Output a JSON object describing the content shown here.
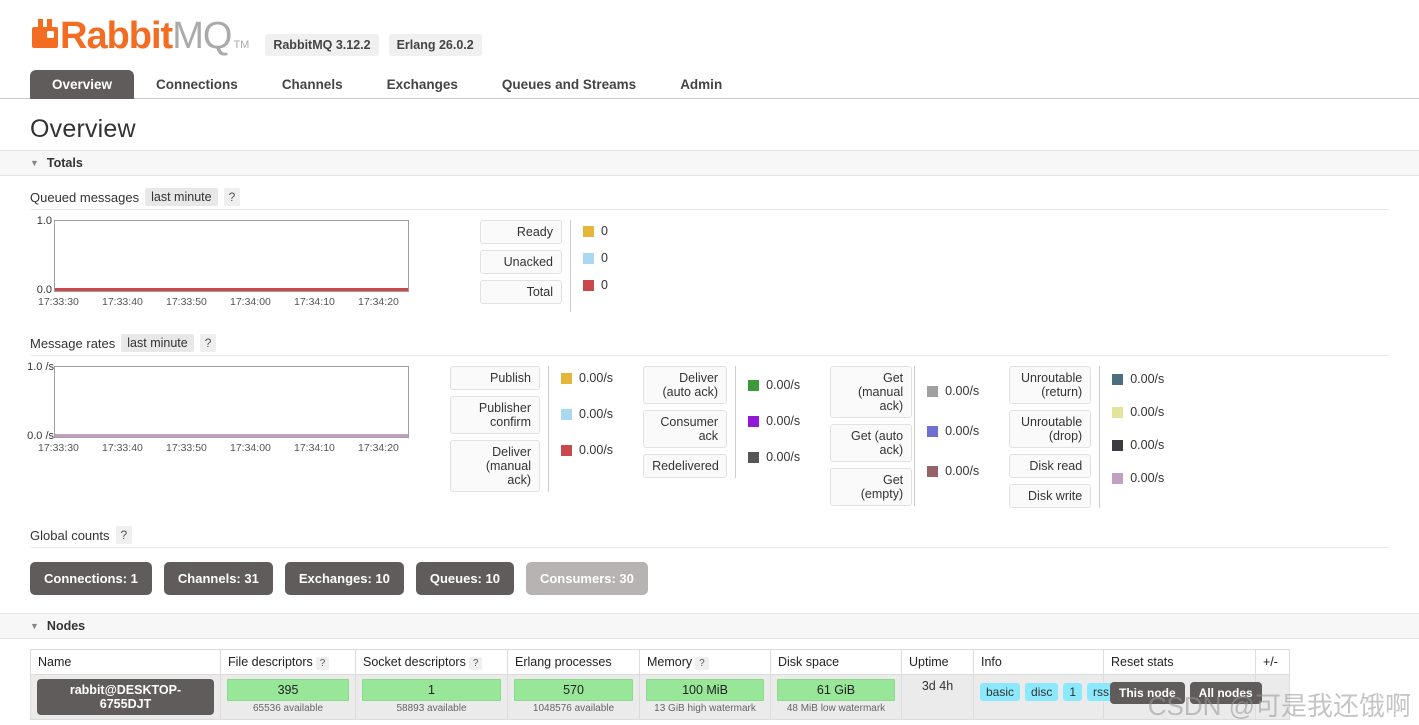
{
  "brand": {
    "name_primary": "Rabbit",
    "name_secondary": "MQ",
    "trademark": "TM",
    "logo_color": "#f36c21",
    "versions": [
      {
        "label": "RabbitMQ 3.12.2"
      },
      {
        "label": "Erlang 26.0.2"
      }
    ]
  },
  "nav": {
    "tabs": [
      {
        "label": "Overview",
        "active": true
      },
      {
        "label": "Connections",
        "active": false
      },
      {
        "label": "Channels",
        "active": false
      },
      {
        "label": "Exchanges",
        "active": false
      },
      {
        "label": "Queues and Streams",
        "active": false
      },
      {
        "label": "Admin",
        "active": false
      }
    ]
  },
  "page": {
    "title": "Overview"
  },
  "sections": {
    "totals": {
      "label": "Totals",
      "expanded": true
    },
    "nodes": {
      "label": "Nodes",
      "expanded": true
    }
  },
  "queued_messages": {
    "label": "Queued messages",
    "period_chip": "last minute",
    "help": "?",
    "legend": [
      {
        "name": "Ready",
        "value": "0",
        "color": "#e5b63c"
      },
      {
        "name": "Unacked",
        "value": "0",
        "color": "#a9d9f0"
      },
      {
        "name": "Total",
        "value": "0",
        "color": "#c9484b"
      }
    ]
  },
  "message_rates": {
    "label": "Message rates",
    "period_chip": "last minute",
    "help": "?",
    "legend_groups": [
      {
        "items": [
          {
            "name": "Publish",
            "value": "0.00/s",
            "color": "#e5b63c"
          },
          {
            "name": "Publisher confirm",
            "value": "0.00/s",
            "color": "#a9d9f0"
          },
          {
            "name": "Deliver (manual ack)",
            "value": "0.00/s",
            "color": "#c9484b"
          }
        ]
      },
      {
        "items": [
          {
            "name": "Deliver (auto ack)",
            "value": "0.00/s",
            "color": "#3c9a3c"
          },
          {
            "name": "Consumer ack",
            "value": "0.00/s",
            "color": "#9317d8"
          },
          {
            "name": "Redelivered",
            "value": "0.00/s",
            "color": "#565656"
          }
        ]
      },
      {
        "items": [
          {
            "name": "Get (manual ack)",
            "value": "0.00/s",
            "color": "#a0a0a0"
          },
          {
            "name": "Get (auto ack)",
            "value": "0.00/s",
            "color": "#6f6fd0"
          },
          {
            "name": "Get (empty)",
            "value": "0.00/s",
            "color": "#96636a"
          }
        ]
      },
      {
        "items": [
          {
            "name": "Unroutable (return)",
            "value": "0.00/s",
            "color": "#4c6f7f"
          },
          {
            "name": "Unroutable (drop)",
            "value": "0.00/s",
            "color": "#e3e39b"
          },
          {
            "name": "Disk read",
            "value": "0.00/s",
            "color": "#3b3b42"
          },
          {
            "name": "Disk write",
            "value": "0.00/s",
            "color": "#c39ec3"
          }
        ]
      }
    ]
  },
  "global_counts": {
    "label": "Global counts",
    "help": "?",
    "badges": [
      {
        "label": "Connections: 1",
        "muted": false
      },
      {
        "label": "Channels: 31",
        "muted": false
      },
      {
        "label": "Exchanges: 10",
        "muted": false
      },
      {
        "label": "Queues: 10",
        "muted": false
      },
      {
        "label": "Consumers: 30",
        "muted": true
      }
    ]
  },
  "nodes_table": {
    "columns": [
      {
        "label": "Name",
        "help": false
      },
      {
        "label": "File descriptors",
        "help": true
      },
      {
        "label": "Socket descriptors",
        "help": true
      },
      {
        "label": "Erlang processes",
        "help": false
      },
      {
        "label": "Memory",
        "help": true
      },
      {
        "label": "Disk space",
        "help": false
      },
      {
        "label": "Uptime",
        "help": false
      },
      {
        "label": "Info",
        "help": false
      },
      {
        "label": "Reset stats",
        "help": false
      },
      {
        "label": "+/-",
        "help": false
      }
    ],
    "row": {
      "name": "rabbit@DESKTOP-6755DJT",
      "file_descriptors": {
        "value": "395",
        "note": "65536 available"
      },
      "socket_descriptors": {
        "value": "1",
        "note": "58893 available"
      },
      "erlang_processes": {
        "value": "570",
        "note": "1048576 available"
      },
      "memory": {
        "value": "100 MiB",
        "note": "13 GiB high watermark"
      },
      "disk_space": {
        "value": "61 GiB",
        "note": "48 MiB low watermark"
      },
      "uptime": "3d 4h",
      "info": [
        "basic",
        "disc",
        "1",
        "rss"
      ],
      "reset_stats": [
        "This node",
        "All nodes"
      ]
    },
    "bar_color": "#98e698"
  },
  "chart_data": [
    {
      "type": "line",
      "title": "Queued messages",
      "xlabel": "",
      "ylabel": "",
      "ylim": [
        0.0,
        1.0
      ],
      "ytick_labels": [
        "1.0",
        "0.0"
      ],
      "xtick_labels": [
        "17:33:30",
        "17:33:40",
        "17:33:50",
        "17:34:00",
        "17:34:10",
        "17:34:20"
      ],
      "grid": false,
      "legend_position": "right",
      "series": [
        {
          "name": "Ready",
          "color": "#e5b63c",
          "values": [
            0,
            0,
            0,
            0,
            0,
            0
          ]
        },
        {
          "name": "Unacked",
          "color": "#a9d9f0",
          "values": [
            0,
            0,
            0,
            0,
            0,
            0
          ]
        },
        {
          "name": "Total",
          "color": "#c9484b",
          "values": [
            0,
            0,
            0,
            0,
            0,
            0
          ]
        }
      ]
    },
    {
      "type": "line",
      "title": "Message rates",
      "xlabel": "",
      "ylabel": "/s",
      "ylim": [
        0.0,
        1.0
      ],
      "ytick_labels": [
        "1.0 /s",
        "0.0 /s"
      ],
      "xtick_labels": [
        "17:33:30",
        "17:33:40",
        "17:33:50",
        "17:34:00",
        "17:34:10",
        "17:34:20"
      ],
      "grid": false,
      "legend_position": "right",
      "series": [
        {
          "name": "Publish",
          "color": "#e5b63c",
          "values": [
            0,
            0,
            0,
            0,
            0,
            0
          ]
        },
        {
          "name": "Publisher confirm",
          "color": "#a9d9f0",
          "values": [
            0,
            0,
            0,
            0,
            0,
            0
          ]
        },
        {
          "name": "Deliver (manual ack)",
          "color": "#c9484b",
          "values": [
            0,
            0,
            0,
            0,
            0,
            0
          ]
        },
        {
          "name": "Deliver (auto ack)",
          "color": "#3c9a3c",
          "values": [
            0,
            0,
            0,
            0,
            0,
            0
          ]
        },
        {
          "name": "Consumer ack",
          "color": "#9317d8",
          "values": [
            0,
            0,
            0,
            0,
            0,
            0
          ]
        },
        {
          "name": "Redelivered",
          "color": "#565656",
          "values": [
            0,
            0,
            0,
            0,
            0,
            0
          ]
        },
        {
          "name": "Get (manual ack)",
          "color": "#a0a0a0",
          "values": [
            0,
            0,
            0,
            0,
            0,
            0
          ]
        },
        {
          "name": "Get (auto ack)",
          "color": "#6f6fd0",
          "values": [
            0,
            0,
            0,
            0,
            0,
            0
          ]
        },
        {
          "name": "Get (empty)",
          "color": "#96636a",
          "values": [
            0,
            0,
            0,
            0,
            0,
            0
          ]
        },
        {
          "name": "Unroutable (return)",
          "color": "#4c6f7f",
          "values": [
            0,
            0,
            0,
            0,
            0,
            0
          ]
        },
        {
          "name": "Unroutable (drop)",
          "color": "#e3e39b",
          "values": [
            0,
            0,
            0,
            0,
            0,
            0
          ]
        },
        {
          "name": "Disk read",
          "color": "#3b3b42",
          "values": [
            0,
            0,
            0,
            0,
            0,
            0
          ]
        },
        {
          "name": "Disk write",
          "color": "#c39ec3",
          "values": [
            0,
            0,
            0,
            0,
            0,
            0
          ]
        }
      ]
    }
  ],
  "watermark": {
    "text": "CSDN @可是我还饿啊"
  }
}
